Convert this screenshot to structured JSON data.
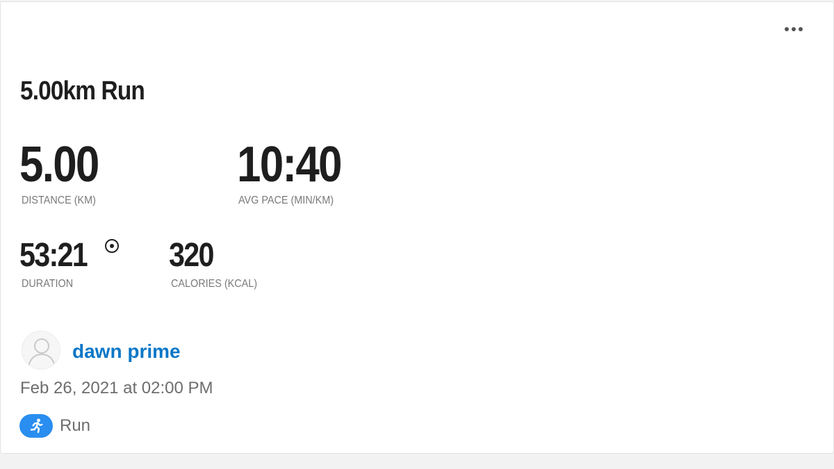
{
  "activity": {
    "title": "5.00km Run",
    "more_menu_icon": "ellipsis-horizontal-icon"
  },
  "stats": {
    "distance": {
      "value": "5.00",
      "label": "DISTANCE (KM)"
    },
    "avg_pace": {
      "value": "10:40",
      "label": "AVG PACE (MIN/KM)"
    },
    "duration": {
      "value": "53:21",
      "label": "DURATION",
      "icon": "radio-target-icon"
    },
    "calories": {
      "value": "320",
      "label": "CALORIES (KCAL)"
    }
  },
  "athlete": {
    "name": "dawn prime",
    "avatar_icon": "user-silhouette-icon"
  },
  "timestamp": "Feb 26, 2021 at 02:00 PM",
  "activity_type": {
    "label": "Run",
    "icon": "running-person-icon",
    "badge_color": "#2a8ef0"
  },
  "colors": {
    "link": "#0a77c7",
    "label_gray": "#7a7a7a",
    "value_dark": "#1e1e1e"
  }
}
